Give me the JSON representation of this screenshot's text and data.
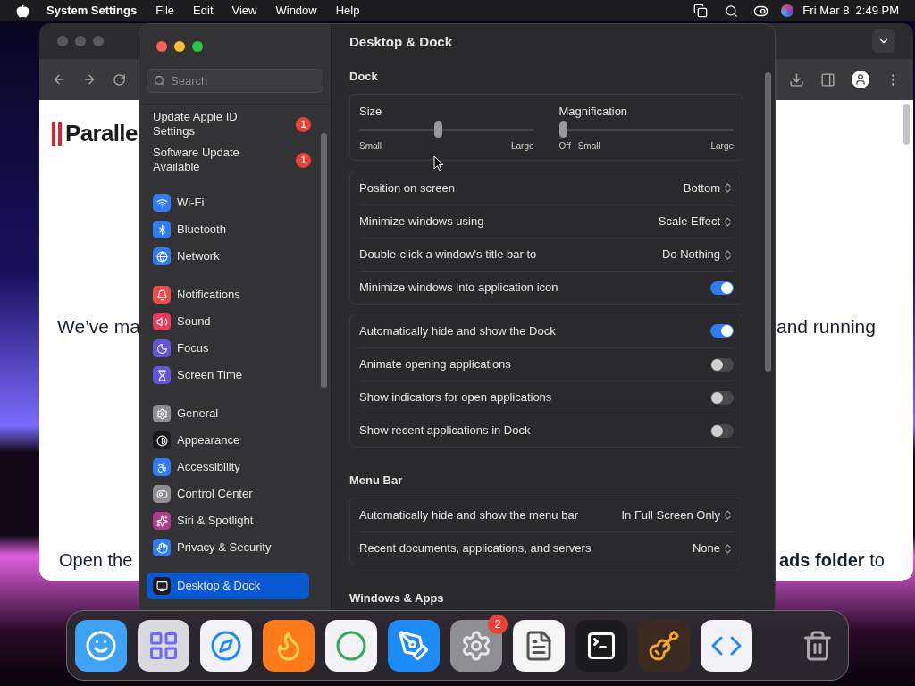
{
  "menu_bar": {
    "app_name": "System Settings",
    "menus": [
      "File",
      "Edit",
      "View",
      "Window",
      "Help"
    ],
    "clock": "Fri Mar 8  2:49 PM"
  },
  "browser": {
    "logo": "Paralle",
    "heading_left": "We’ve ma",
    "heading_right": "and running",
    "text_left": "Open the",
    "text_right": "**ads folder** to"
  },
  "settings": {
    "search": {
      "placeholder": "Search"
    },
    "alerts": [
      {
        "label": "Update Apple ID Settings",
        "badge": "1"
      },
      {
        "label": "Software Update Available",
        "badge": "1"
      }
    ],
    "groups": [
      {
        "items": [
          {
            "kind": "wifi",
            "label": "Wi-Fi",
            "color": "#2f7cf6",
            "selected": false
          },
          {
            "kind": "bluetooth",
            "label": "Bluetooth",
            "color": "#2f7cf6",
            "selected": false
          },
          {
            "kind": "network",
            "label": "Network",
            "color": "#2f7cf6",
            "selected": false
          }
        ]
      },
      {
        "items": [
          {
            "kind": "notifications",
            "label": "Notifications",
            "color": "#eb4d4b",
            "selected": false
          },
          {
            "kind": "sound",
            "label": "Sound",
            "color": "#eb3b5a",
            "selected": false
          },
          {
            "kind": "focus",
            "label": "Focus",
            "color": "#6355d8",
            "selected": false
          },
          {
            "kind": "screentime",
            "label": "Screen Time",
            "color": "#6355d8",
            "selected": false
          }
        ]
      },
      {
        "items": [
          {
            "kind": "general",
            "label": "General",
            "color": "#8e8e93",
            "selected": false
          },
          {
            "kind": "appearance",
            "label": "Appearance",
            "color": "#1c1c1e",
            "selected": false
          },
          {
            "kind": "accessibility",
            "label": "Accessibility",
            "color": "#2f7cf6",
            "selected": false
          },
          {
            "kind": "controlcenter",
            "label": "Control Center",
            "color": "#8e8e93",
            "selected": false
          },
          {
            "kind": "siri",
            "label": "Siri & Spotlight",
            "color": "#b03a8e",
            "selected": false
          },
          {
            "kind": "privacy",
            "label": "Privacy & Security",
            "color": "#2f7cf6",
            "selected": false
          }
        ]
      },
      {
        "items": [
          {
            "kind": "desktop",
            "label": "Desktop & Dock",
            "color": "#1c1c1e",
            "selected": true
          }
        ]
      }
    ]
  },
  "panel": {
    "title": "Desktop & Dock",
    "sections": [
      {
        "heading": "Dock",
        "cards": [
          {
            "kind": "sliders",
            "sliders": [
              {
                "label": "Size",
                "level": 0.45,
                "min_label": "Small",
                "max_label": "Large"
              },
              {
                "label": "Magnification",
                "level": 0,
                "off_label": "Off",
                "min_label": "Small",
                "max_label": "Large"
              }
            ]
          },
          {
            "kind": "rows",
            "rows": [
              {
                "kind": "popup",
                "label": "Position on screen",
                "value": "Bottom"
              },
              {
                "kind": "popup",
                "label": "Minimize windows using",
                "value": "Scale Effect"
              },
              {
                "kind": "popup",
                "label": "Double-click a window's title bar to",
                "value": "Do Nothing"
              },
              {
                "kind": "toggle",
                "label": "Minimize windows into application icon",
                "on": true
              }
            ]
          },
          {
            "kind": "rows",
            "rows": [
              {
                "kind": "toggle",
                "label": "Automatically hide and show the Dock",
                "on": true
              },
              {
                "kind": "toggle",
                "label": "Animate opening applications",
                "on": false
              },
              {
                "kind": "toggle",
                "label": "Show indicators for open applications",
                "on": false
              },
              {
                "kind": "toggle",
                "label": "Show recent applications in Dock",
                "on": false
              }
            ]
          }
        ]
      },
      {
        "heading": "Menu Bar",
        "cards": [
          {
            "kind": "rows",
            "rows": [
              {
                "kind": "popup",
                "label": "Automatically hide and show the menu bar",
                "value": "In Full Screen Only"
              },
              {
                "kind": "popup",
                "label": "Recent documents, applications, and servers",
                "value": "None"
              }
            ]
          }
        ]
      },
      {
        "heading": "Windows & Apps"
      }
    ]
  },
  "dock": {
    "items": [
      {
        "kind": "finder"
      },
      {
        "kind": "launchpad"
      },
      {
        "kind": "safari"
      },
      {
        "kind": "firefox"
      },
      {
        "kind": "chrome"
      },
      {
        "kind": "appstore"
      },
      {
        "kind": "settings",
        "badge": "2"
      },
      {
        "kind": "textedit"
      },
      {
        "kind": "terminal"
      },
      {
        "kind": "garageband"
      },
      {
        "kind": "vscode"
      },
      {
        "kind": "trash"
      }
    ]
  }
}
